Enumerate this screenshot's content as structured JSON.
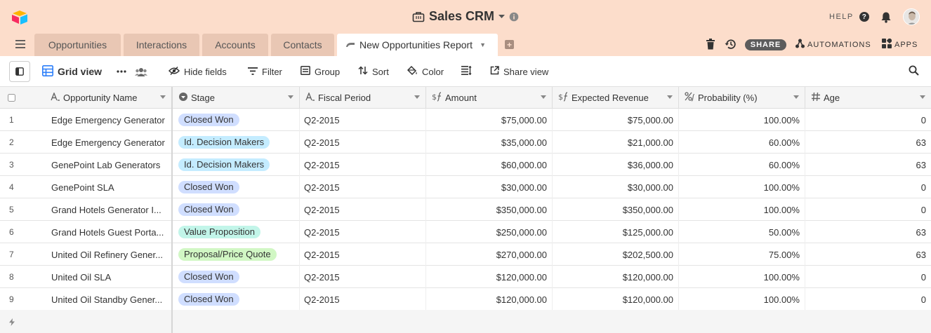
{
  "app": {
    "base_title": "Sales CRM",
    "help_label": "HELP"
  },
  "tabs": [
    {
      "label": "Opportunities"
    },
    {
      "label": "Interactions"
    },
    {
      "label": "Accounts"
    },
    {
      "label": "Contacts"
    },
    {
      "label": "New Opportunities Report"
    }
  ],
  "header_actions": {
    "share_label": "SHARE",
    "automations_label": "AUTOMATIONS",
    "apps_label": "APPS"
  },
  "viewbar": {
    "view_name": "Grid view",
    "hide_fields": "Hide fields",
    "filter": "Filter",
    "group": "Group",
    "sort": "Sort",
    "color": "Color",
    "share_view": "Share view"
  },
  "columns": [
    {
      "label": "Opportunity Name"
    },
    {
      "label": "Stage"
    },
    {
      "label": "Fiscal Period"
    },
    {
      "label": "Amount"
    },
    {
      "label": "Expected Revenue"
    },
    {
      "label": "Probability (%)"
    },
    {
      "label": "Age"
    }
  ],
  "stage_colors": {
    "Closed Won": "#d0deff",
    "Id. Decision Makers": "#c4ecff",
    "Value Proposition": "#c2f5e9",
    "Proposal/Price Quote": "#d1f7c4"
  },
  "rows": [
    {
      "num": "1",
      "name": "Edge Emergency Generator",
      "stage": "Closed Won",
      "period": "Q2-2015",
      "amount": "$75,000.00",
      "revenue": "$75,000.00",
      "prob": "100.00%",
      "age": "0"
    },
    {
      "num": "2",
      "name": "Edge Emergency Generator",
      "stage": "Id. Decision Makers",
      "period": "Q2-2015",
      "amount": "$35,000.00",
      "revenue": "$21,000.00",
      "prob": "60.00%",
      "age": "63"
    },
    {
      "num": "3",
      "name": "GenePoint Lab Generators",
      "stage": "Id. Decision Makers",
      "period": "Q2-2015",
      "amount": "$60,000.00",
      "revenue": "$36,000.00",
      "prob": "60.00%",
      "age": "63"
    },
    {
      "num": "4",
      "name": "GenePoint SLA",
      "stage": "Closed Won",
      "period": "Q2-2015",
      "amount": "$30,000.00",
      "revenue": "$30,000.00",
      "prob": "100.00%",
      "age": "0"
    },
    {
      "num": "5",
      "name": "Grand Hotels Generator I...",
      "stage": "Closed Won",
      "period": "Q2-2015",
      "amount": "$350,000.00",
      "revenue": "$350,000.00",
      "prob": "100.00%",
      "age": "0"
    },
    {
      "num": "6",
      "name": "Grand Hotels Guest Porta...",
      "stage": "Value Proposition",
      "period": "Q2-2015",
      "amount": "$250,000.00",
      "revenue": "$125,000.00",
      "prob": "50.00%",
      "age": "63"
    },
    {
      "num": "7",
      "name": "United Oil Refinery Gener...",
      "stage": "Proposal/Price Quote",
      "period": "Q2-2015",
      "amount": "$270,000.00",
      "revenue": "$202,500.00",
      "prob": "75.00%",
      "age": "63"
    },
    {
      "num": "8",
      "name": "United Oil SLA",
      "stage": "Closed Won",
      "period": "Q2-2015",
      "amount": "$120,000.00",
      "revenue": "$120,000.00",
      "prob": "100.00%",
      "age": "0"
    },
    {
      "num": "9",
      "name": "United Oil Standby Gener...",
      "stage": "Closed Won",
      "period": "Q2-2015",
      "amount": "$120,000.00",
      "revenue": "$120,000.00",
      "prob": "100.00%",
      "age": "0"
    }
  ]
}
